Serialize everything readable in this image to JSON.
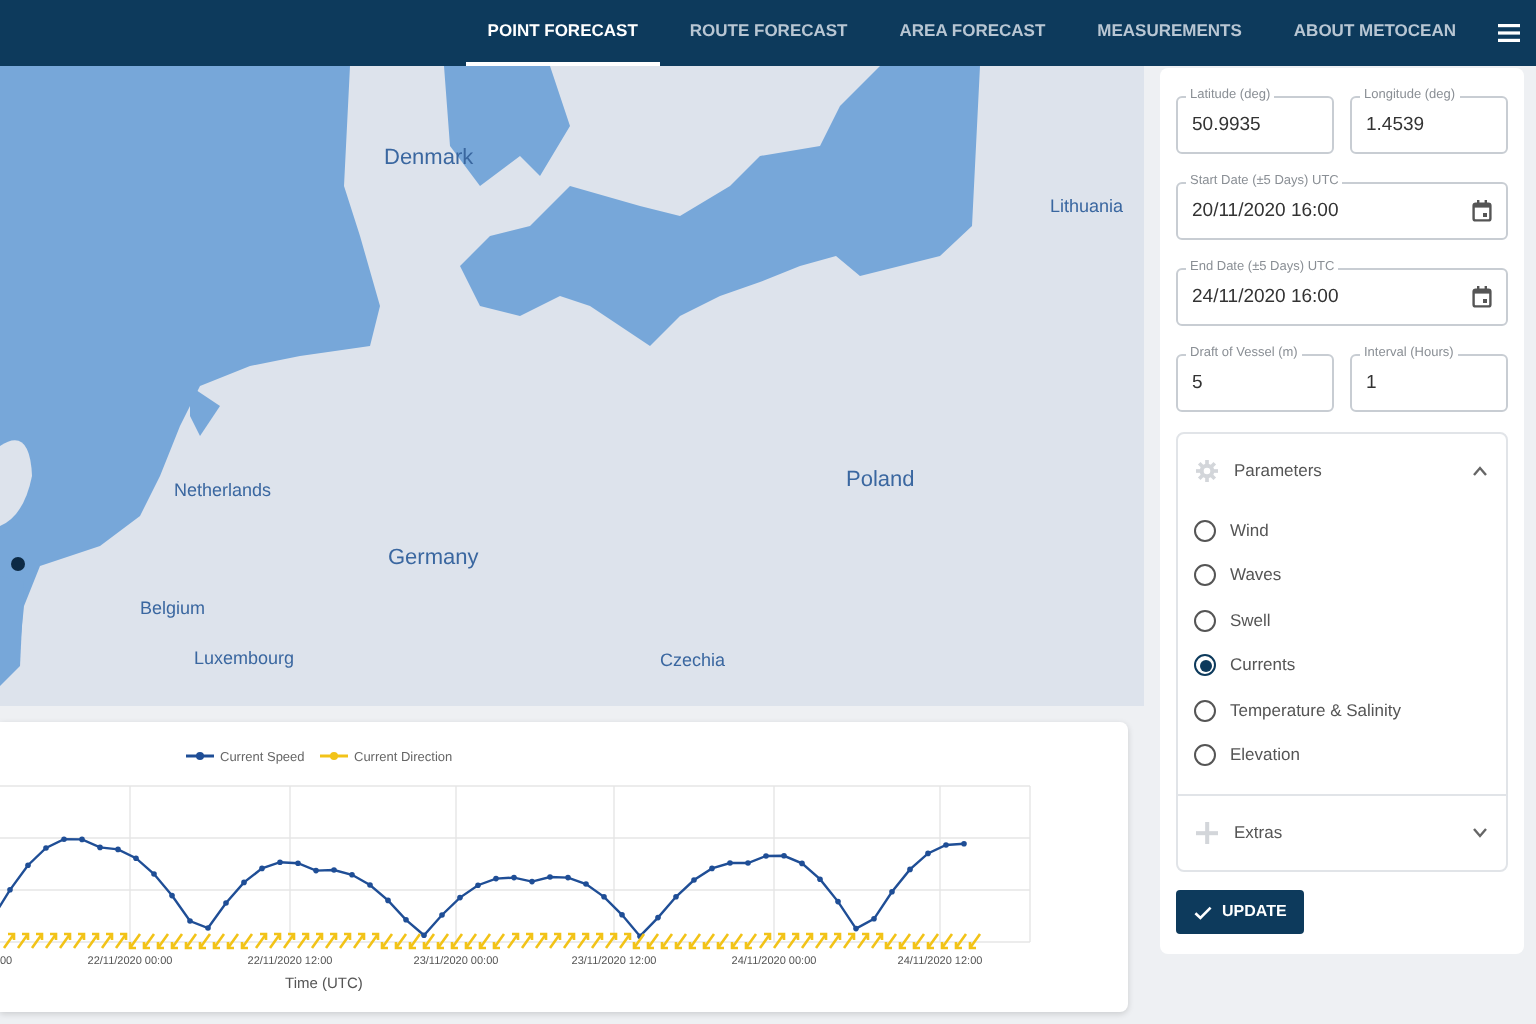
{
  "nav": {
    "items": [
      {
        "label": "POINT FORECAST",
        "selected": true
      },
      {
        "label": "ROUTE FORECAST",
        "selected": false
      },
      {
        "label": "AREA FORECAST",
        "selected": false
      },
      {
        "label": "MEASUREMENTS",
        "selected": false
      },
      {
        "label": "ABOUT METOCEAN",
        "selected": false
      }
    ]
  },
  "map": {
    "labels": [
      {
        "text": "Denmark",
        "kind": "country"
      },
      {
        "text": "Lithuania",
        "kind": "country"
      },
      {
        "text": "Netherlands",
        "kind": "country"
      },
      {
        "text": "Poland",
        "kind": "country"
      },
      {
        "text": "Germany",
        "kind": "country"
      },
      {
        "text": "Belgium",
        "kind": "country"
      },
      {
        "text": "Luxembourg",
        "kind": "country"
      },
      {
        "text": "Czechia",
        "kind": "country"
      }
    ]
  },
  "chart": {
    "legend": [
      {
        "name": "Current Speed",
        "color": "#1f4e96"
      },
      {
        "name": "Current Direction",
        "color": "#f2c318"
      }
    ],
    "x_tick_labels": [
      "00",
      "22/11/2020 00:00",
      "22/11/2020 12:00",
      "23/11/2020 00:00",
      "23/11/2020 12:00",
      "24/11/2020 00:00",
      "24/11/2020 12:00"
    ],
    "xlabel": "Time (UTC)"
  },
  "form": {
    "fields": [
      {
        "label": "Latitude (deg)",
        "value": "50.9935",
        "kind": "text"
      },
      {
        "label": "Longitude (deg)",
        "value": "1.4539",
        "kind": "text"
      },
      {
        "label": "Start Date (±5 Days) UTC",
        "value": "20/11/2020 16:00",
        "kind": "date"
      },
      {
        "label": "End Date (±5 Days) UTC",
        "value": "24/11/2020 16:00",
        "kind": "date"
      },
      {
        "label": "Draft of Vessel (m)",
        "value": "5",
        "kind": "text"
      },
      {
        "label": "Interval (Hours)",
        "value": "1",
        "kind": "text"
      }
    ],
    "sections": [
      {
        "title": "Parameters",
        "kind": "gear",
        "expanded": true,
        "options": [
          {
            "label": "Wind",
            "selected": false
          },
          {
            "label": "Waves",
            "selected": false
          },
          {
            "label": "Swell",
            "selected": false
          },
          {
            "label": "Currents",
            "selected": true
          },
          {
            "label": "Temperature & Salinity",
            "selected": false
          },
          {
            "label": "Elevation",
            "selected": false
          }
        ]
      },
      {
        "title": "Extras",
        "kind": "plus",
        "expanded": false
      }
    ],
    "button": "UPDATE"
  }
}
